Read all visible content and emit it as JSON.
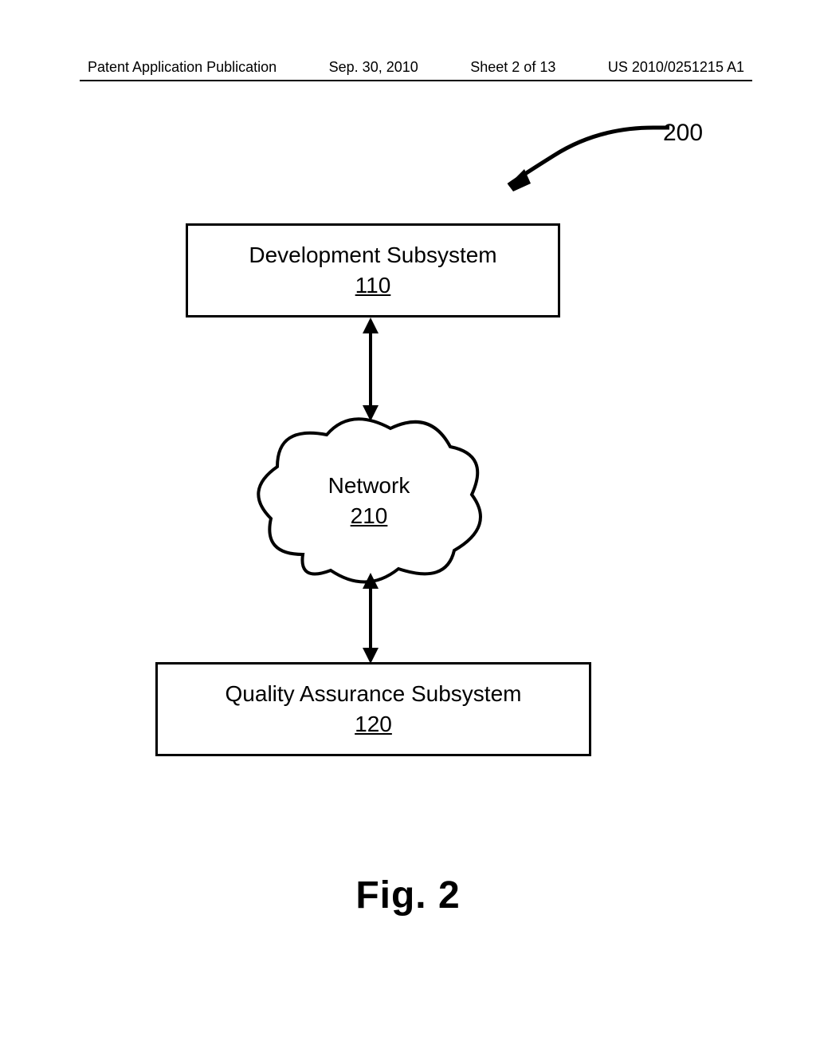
{
  "header": {
    "pubtype": "Patent Application Publication",
    "date": "Sep. 30, 2010",
    "sheet": "Sheet 2 of 13",
    "docnum": "US 2010/0251215 A1"
  },
  "ref_number": "200",
  "box1": {
    "label": "Development Subsystem",
    "num": "110"
  },
  "cloud": {
    "label": "Network",
    "num": "210"
  },
  "box2": {
    "label": "Quality Assurance Subsystem",
    "num": "120"
  },
  "fig": "Fig. 2",
  "chart_data": {
    "type": "diagram",
    "title": "Fig. 2",
    "reference_numeral": "200",
    "nodes": [
      {
        "id": "110",
        "label": "Development Subsystem",
        "shape": "rect"
      },
      {
        "id": "210",
        "label": "Network",
        "shape": "cloud"
      },
      {
        "id": "120",
        "label": "Quality Assurance Subsystem",
        "shape": "rect"
      }
    ],
    "edges": [
      {
        "from": "110",
        "to": "210",
        "direction": "bidirectional"
      },
      {
        "from": "210",
        "to": "120",
        "direction": "bidirectional"
      }
    ]
  }
}
